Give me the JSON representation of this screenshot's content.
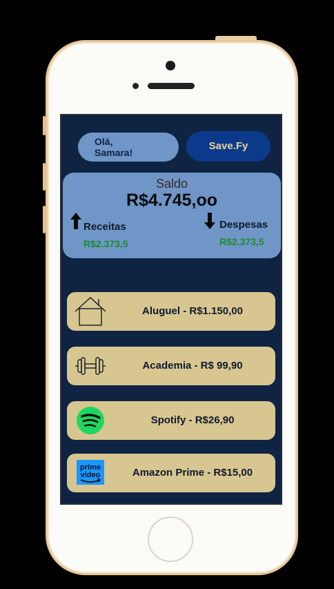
{
  "header": {
    "greeting": "Olá,\nSamara!",
    "brand": "Save.Fy"
  },
  "balance": {
    "title": "Saldo",
    "value": "R$4.745,oo",
    "income_label": "Receitas",
    "income_value": "R$2.373,5",
    "expense_label": "Despesas",
    "expense_value": "R$2.373,5"
  },
  "expenses": [
    {
      "icon": "house-icon",
      "label": "Aluguel - R$1.150,00"
    },
    {
      "icon": "dumbbell-icon",
      "label": "Academia - R$ 99,90"
    },
    {
      "icon": "spotify-icon",
      "label": "Spotify - R$26,90"
    },
    {
      "icon": "prime-video-icon",
      "label": "Amazon Prime - R$15,00",
      "icon_text": "prime video"
    }
  ],
  "colors": {
    "screen_bg": "#0f2342",
    "card_blue": "#6f96c7",
    "brand_blue": "#0c3a8b",
    "item_gold": "#d8c691",
    "positive_green": "#1f8a2e",
    "spotify_green": "#1ed760",
    "prime_blue": "#1a98ff"
  }
}
